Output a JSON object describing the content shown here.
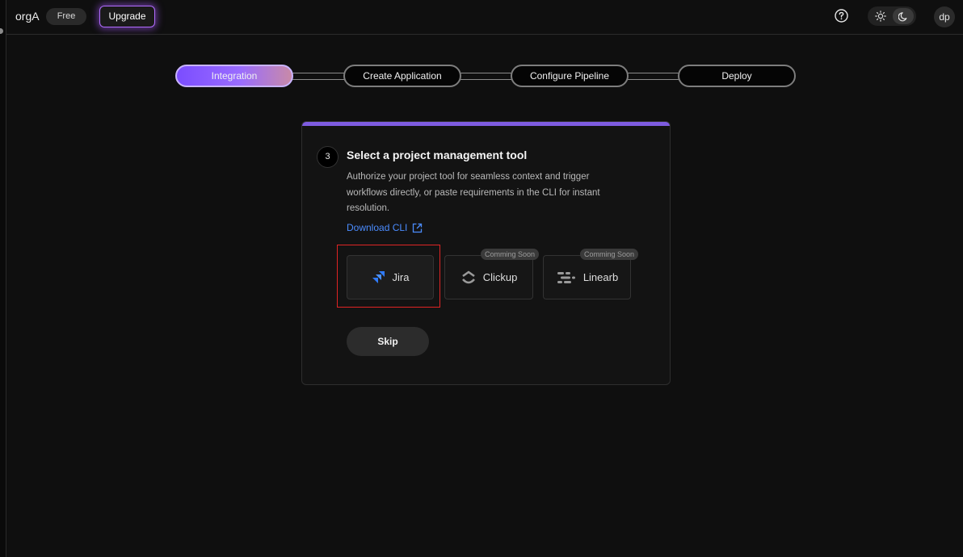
{
  "header": {
    "org_name": "orgA",
    "plan_badge": "Free",
    "upgrade_label": "Upgrade",
    "avatar_initials": "dp",
    "icons": [
      "help-icon",
      "sun-icon",
      "moon-icon"
    ]
  },
  "stepper": {
    "steps": [
      {
        "label": "Integration",
        "active": true
      },
      {
        "label": "Create Application",
        "active": false
      },
      {
        "label": "Configure Pipeline",
        "active": false
      },
      {
        "label": "Deploy",
        "active": false
      }
    ]
  },
  "card": {
    "step_number": "3",
    "title": "Select a project management tool",
    "description": "Authorize your project tool for seamless context and trigger workflows directly, or paste requirements in the CLI for instant resolution.",
    "download_link": "Download CLI",
    "tools": [
      {
        "name": "Jira",
        "badge": "",
        "icon": "jira-icon"
      },
      {
        "name": "Clickup",
        "badge": "Comming Soon",
        "icon": "clickup-icon"
      },
      {
        "name": "Linearb",
        "badge": "Comming Soon",
        "icon": "linearb-icon"
      }
    ],
    "skip_label": "Skip"
  },
  "colors": {
    "accent": "#7e5ce0",
    "link": "#4b8cff",
    "highlight": "#e02424",
    "upgrade_glow": "#b26cff"
  }
}
